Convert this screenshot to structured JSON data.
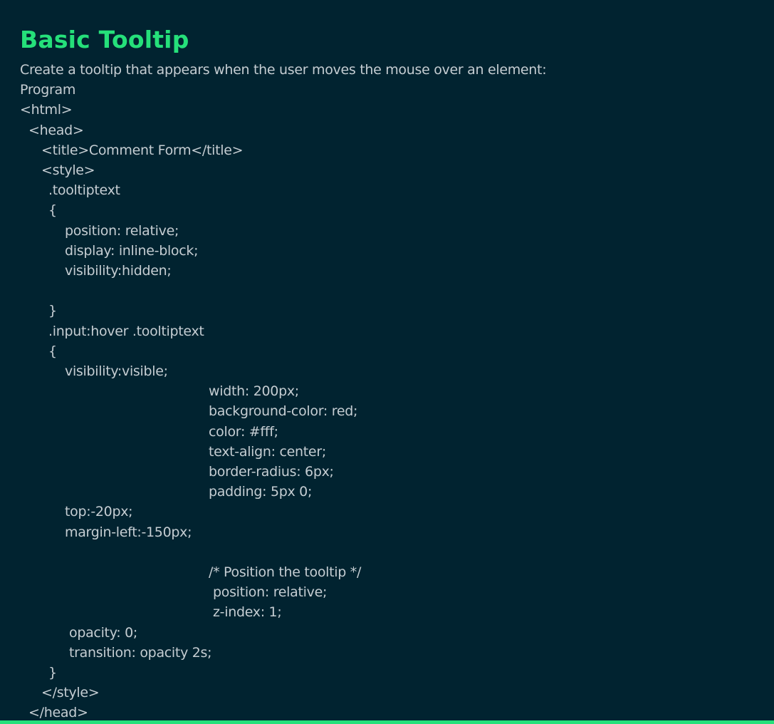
{
  "theme": {
    "background": "#012330",
    "heading_color": "#25e07a",
    "text_color": "#c5cdd2",
    "bottom_bar_color": "#25e07a"
  },
  "heading": "Basic Tooltip",
  "lines": [
    {
      "text": "Create a tooltip that appears when the user moves the mouse over an element:",
      "indent": 0
    },
    {
      "text": "Program",
      "indent": 0
    },
    {
      "text": "<html>",
      "indent": 0
    },
    {
      "text": "<head>",
      "indent": 12
    },
    {
      "text": "<title>Comment Form</title>",
      "indent": 30
    },
    {
      "text": "<style>",
      "indent": 30
    },
    {
      "text": ".tooltiptext",
      "indent": 40
    },
    {
      "text": "{",
      "indent": 40
    },
    {
      "text": "position: relative;",
      "indent": 63
    },
    {
      "text": "display: inline-block;",
      "indent": 63
    },
    {
      "text": "visibility:hidden;",
      "indent": 63
    },
    {
      "text": "",
      "indent": 0
    },
    {
      "text": "}",
      "indent": 40
    },
    {
      "text": ".input:hover .tooltiptext",
      "indent": 40
    },
    {
      "text": "{",
      "indent": 40
    },
    {
      "text": "visibility:visible;",
      "indent": 63
    },
    {
      "text": "width: 200px;",
      "indent": 265
    },
    {
      "text": "background-color: red;",
      "indent": 265
    },
    {
      "text": "color: #fff;",
      "indent": 265
    },
    {
      "text": "text-align: center;",
      "indent": 265
    },
    {
      "text": "border-radius: 6px;",
      "indent": 265
    },
    {
      "text": "padding: 5px 0;",
      "indent": 265
    },
    {
      "text": "top:-20px;",
      "indent": 63
    },
    {
      "text": "margin-left:-150px;",
      "indent": 63
    },
    {
      "text": "",
      "indent": 0
    },
    {
      "text": "/* Position the tooltip */",
      "indent": 265
    },
    {
      "text": "position: relative;",
      "indent": 271
    },
    {
      "text": "z-index: 1;",
      "indent": 271
    },
    {
      "text": "opacity: 0;",
      "indent": 69
    },
    {
      "text": "transition: opacity 2s;",
      "indent": 69
    },
    {
      "text": "}",
      "indent": 40
    },
    {
      "text": "</style>",
      "indent": 30
    },
    {
      "text": "</head>",
      "indent": 12
    }
  ]
}
